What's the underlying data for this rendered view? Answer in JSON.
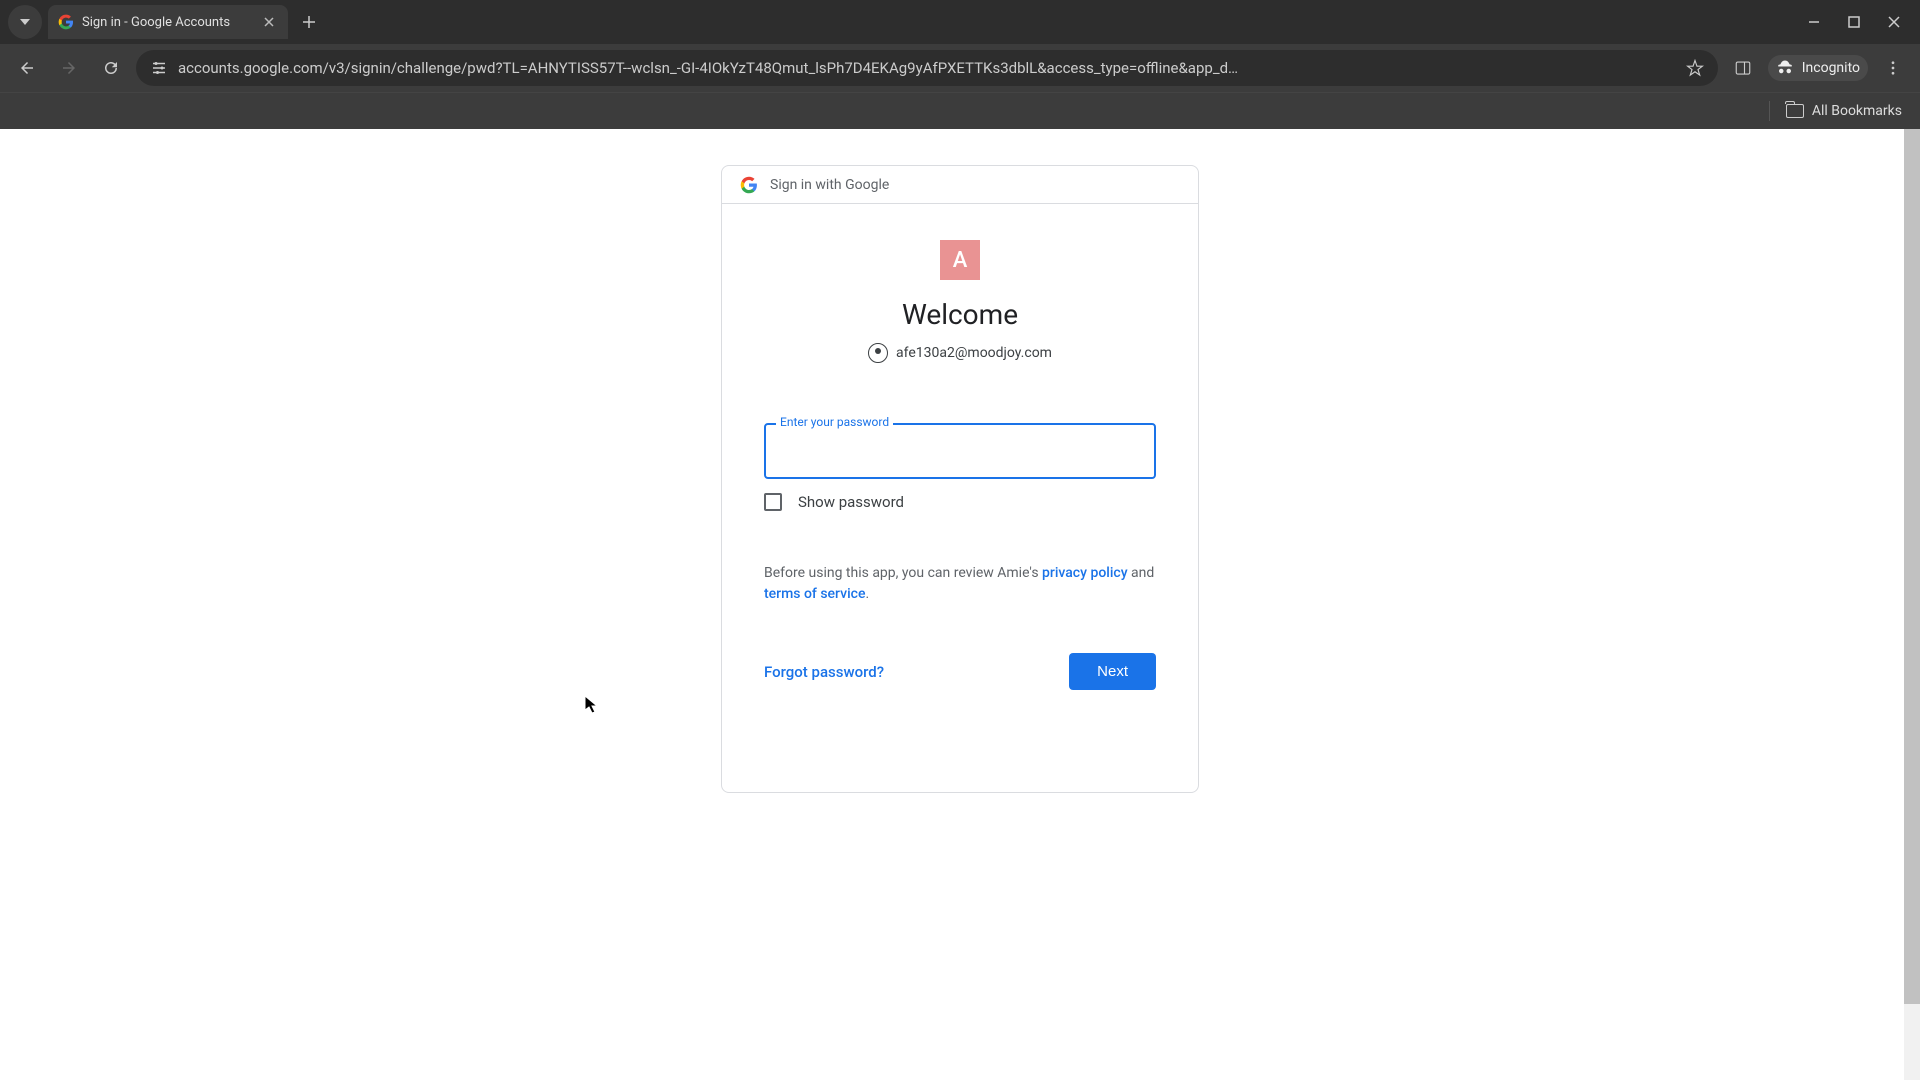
{
  "browser": {
    "tab_title": "Sign in - Google Accounts",
    "url": "accounts.google.com/v3/signin/challenge/pwd?TL=AHNYTISS57T--wclsn_-GI-4IOkYzT48Qmut_lsPh7D4EKAg9yAfPXETTKs3dblL&access_type=offline&app_d…",
    "incognito_label": "Incognito",
    "all_bookmarks_label": "All Bookmarks"
  },
  "signin": {
    "header_text": "Sign in with Google",
    "app_initial": "A",
    "welcome": "Welcome",
    "email": "afe130a2@moodjoy.com",
    "password_label": "Enter your password",
    "show_password_label": "Show password",
    "policy_prefix": "Before using this app, you can review Amie's ",
    "privacy_policy": "privacy policy",
    "policy_and": " and ",
    "terms": "terms of service",
    "policy_suffix": ".",
    "forgot_password": "Forgot password?",
    "next_button": "Next"
  }
}
